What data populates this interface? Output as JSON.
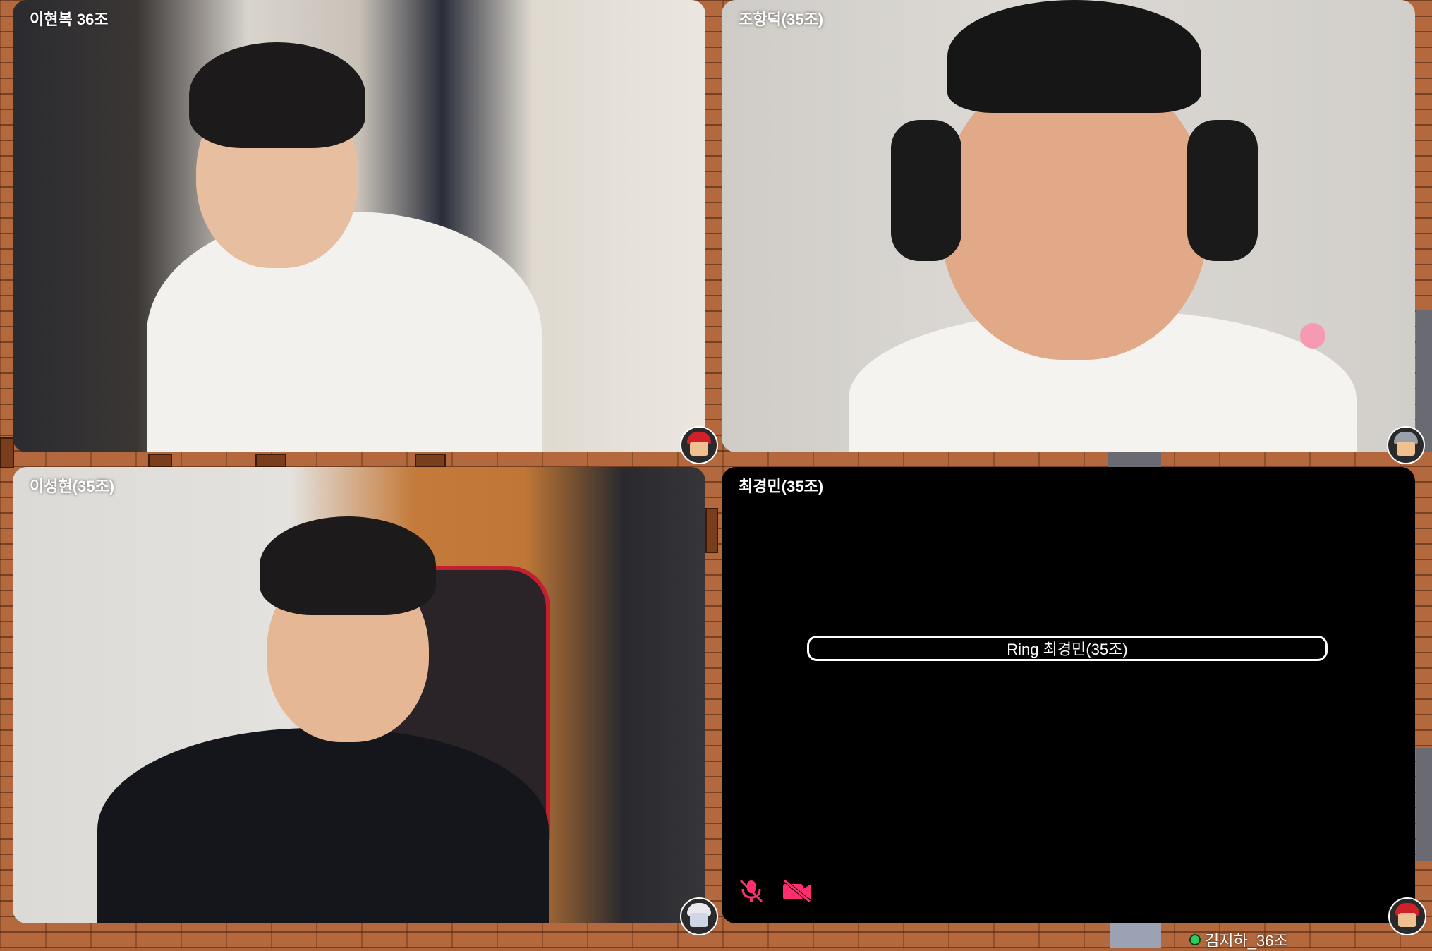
{
  "participants": [
    {
      "name": "이현복 36조"
    },
    {
      "name": "조항덕(35조)"
    },
    {
      "name": "이성현(35조)"
    },
    {
      "name": "최경민(35조)"
    }
  ],
  "ringing": {
    "label": "Ring 최경민(35조)"
  },
  "map": {
    "nearby_player": "김지하_36조"
  },
  "icons": {
    "mic": "mic-muted-icon",
    "camera": "camera-off-icon"
  },
  "colors": {
    "muted": "#ff2e6f",
    "online": "#2fce5a"
  }
}
